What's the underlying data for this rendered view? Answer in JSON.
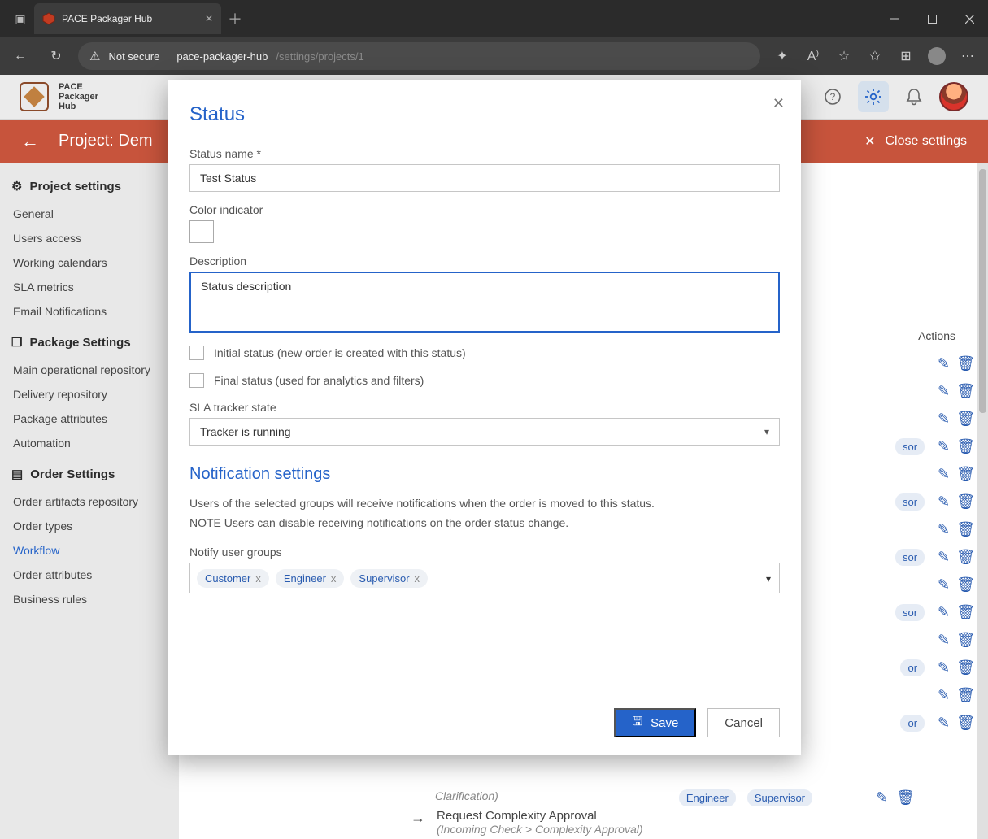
{
  "browser": {
    "tab_title": "PACE Packager Hub",
    "url_warn": "Not secure",
    "url_host": "pace-packager-hub",
    "url_path": "/settings/projects/1"
  },
  "header": {
    "logo_line1": "PACE",
    "logo_line2": "Packager",
    "logo_line3": "Hub"
  },
  "orange": {
    "title": "Project: Dem",
    "close": "Close settings"
  },
  "sidebar": {
    "groups": [
      {
        "title": "Project settings",
        "items": [
          "General",
          "Users access",
          "Working calendars",
          "SLA metrics",
          "Email Notifications"
        ]
      },
      {
        "title": "Package Settings",
        "items": [
          "Main operational repository",
          "Delivery repository",
          "Package attributes",
          "Automation"
        ]
      },
      {
        "title": "Order Settings",
        "items": [
          "Order artifacts repository",
          "Order types",
          "Workflow",
          "Order attributes",
          "Business rules"
        ]
      }
    ],
    "active": "Workflow"
  },
  "bg": {
    "actions_header": "Actions",
    "rows": [
      {
        "chips": []
      },
      {
        "chips": []
      },
      {
        "chips": []
      },
      {
        "chips": [
          "sor"
        ]
      },
      {
        "chips": []
      },
      {
        "chips": [
          "sor"
        ]
      },
      {
        "chips": []
      },
      {
        "chips": [
          "sor"
        ]
      },
      {
        "chips": []
      },
      {
        "chips": [
          "sor"
        ]
      },
      {
        "chips": []
      },
      {
        "chips": [
          "or"
        ]
      },
      {
        "chips": []
      },
      {
        "chips": [
          "or"
        ]
      }
    ]
  },
  "peek": {
    "item1_sub": "Clarification)",
    "item2_title": "Request Complexity Approval",
    "item2_sub": "(Incoming Check > Complexity Approval)",
    "chip1": "Engineer",
    "chip2": "Supervisor"
  },
  "modal": {
    "title": "Status",
    "status_name_label": "Status name *",
    "status_name_value": "Test Status",
    "color_label": "Color indicator",
    "color_value": "#36b24a",
    "desc_label": "Description",
    "desc_value": "Status description",
    "chk_initial": "Initial status (new order is created with this status)",
    "chk_final": "Final status (used for analytics and filters)",
    "sla_label": "SLA tracker state",
    "sla_value": "Tracker is running",
    "notif_title": "Notification settings",
    "notif_help1": "Users of the selected groups will receive notifications when the order is moved to this status.",
    "notif_help2": "NOTE Users can disable receiving notifications on the order status change.",
    "notify_label": "Notify user groups",
    "tags": [
      "Customer",
      "Engineer",
      "Supervisor"
    ],
    "save": "Save",
    "cancel": "Cancel"
  }
}
